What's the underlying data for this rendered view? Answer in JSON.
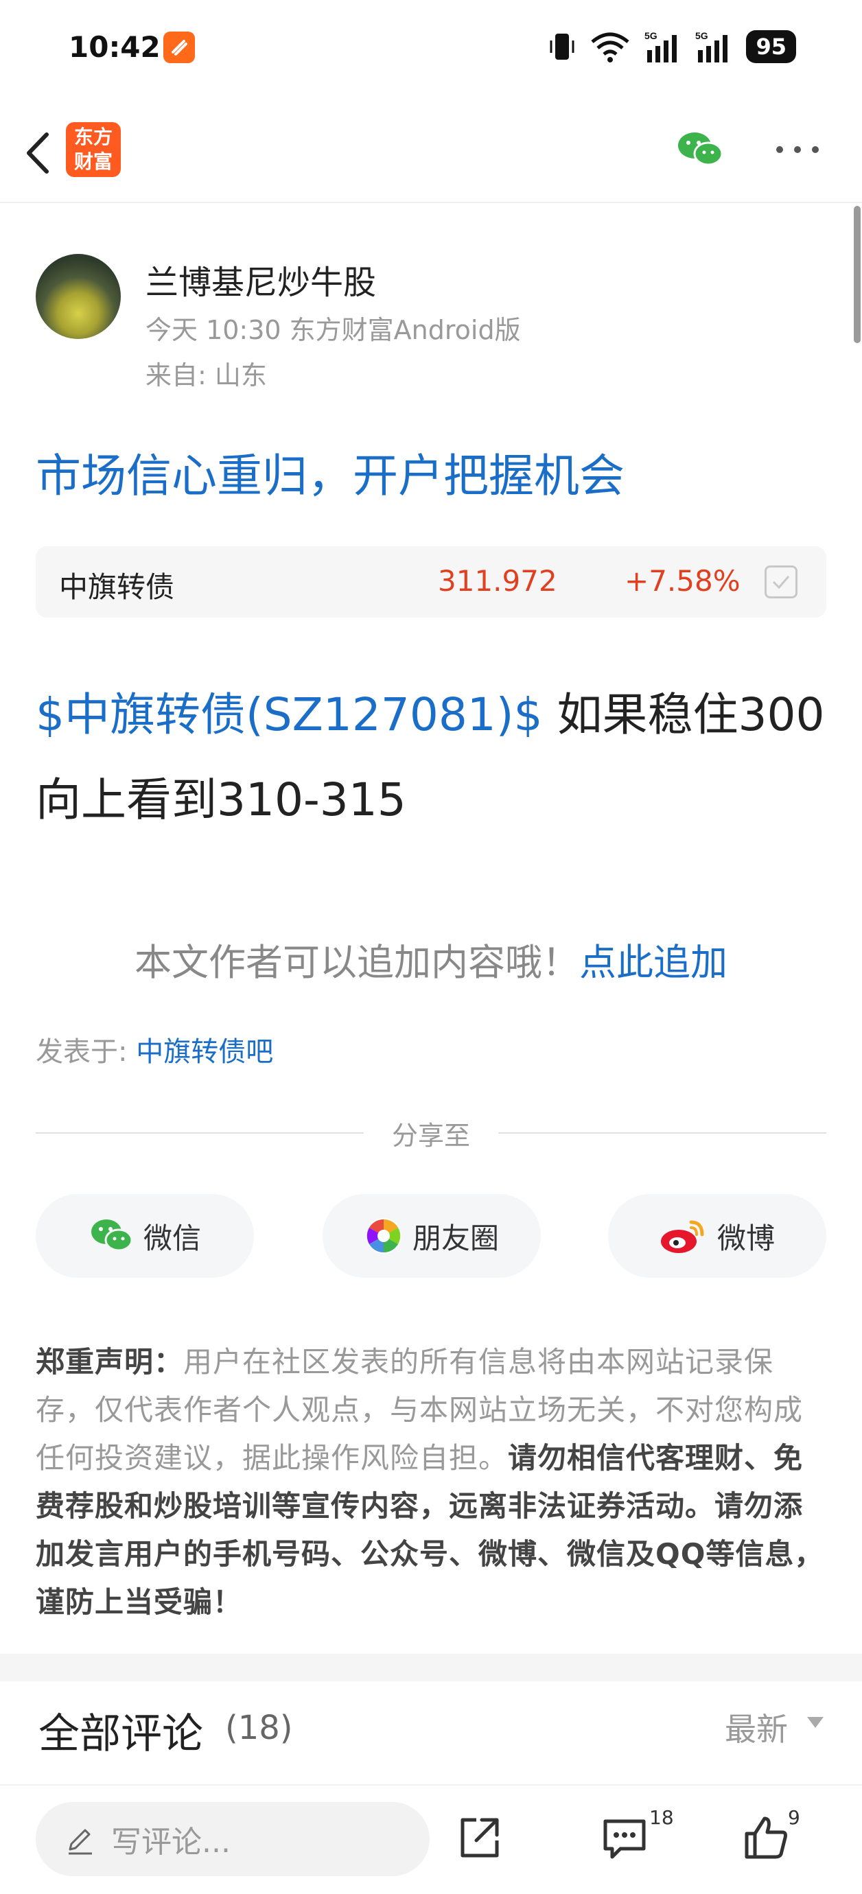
{
  "status_bar": {
    "time": "10:42",
    "battery": "95",
    "signal_labels": [
      "5G",
      "5G"
    ]
  },
  "nav": {
    "logo_text_top": "东方",
    "logo_text_bottom": "财富"
  },
  "author": {
    "name": "兰博基尼炒牛股",
    "meta": "今天 10:30 东方财富Android版",
    "location": "来自: 山东"
  },
  "post": {
    "title": "市场信心重归，开户把握机会",
    "stock_card": {
      "name": "中旗转债",
      "price": "311.972",
      "change": "+7.58%"
    },
    "body_link": "$中旗转债(SZ127081)$",
    "body_text": " 如果稳住300 向上看到310-315",
    "append_prompt": "本文作者可以追加内容哦！",
    "append_link": "点此追加",
    "posted_in_label": "发表于: ",
    "posted_in_link": "中旗转债吧"
  },
  "share": {
    "label": "分享至",
    "buttons": [
      {
        "label": "微信",
        "icon": "wechat-icon"
      },
      {
        "label": "朋友圈",
        "icon": "moments-icon"
      },
      {
        "label": "微博",
        "icon": "weibo-icon"
      }
    ]
  },
  "disclaimer": {
    "heading": "郑重声明：",
    "normal": "用户在社区发表的所有信息将由本网站记录保存，仅代表作者个人观点，与本网站立场无关，不对您构成任何投资建议，据此操作风险自担。",
    "bold": "请勿相信代客理财、免费荐股和炒股培训等宣传内容，远离非法证券活动。请勿添加发言用户的手机号码、公众号、微博、微信及QQ等信息，谨防上当受骗！"
  },
  "comments": {
    "title": "全部评论",
    "count": "(18)",
    "sort": "最新"
  },
  "bottom_bar": {
    "input_placeholder": "写评论...",
    "comment_count": "18",
    "like_count": "9"
  },
  "colors": {
    "accent_blue": "#1a6ec8",
    "rise_red": "#e04020",
    "brand_orange": "#ff5a1f"
  }
}
